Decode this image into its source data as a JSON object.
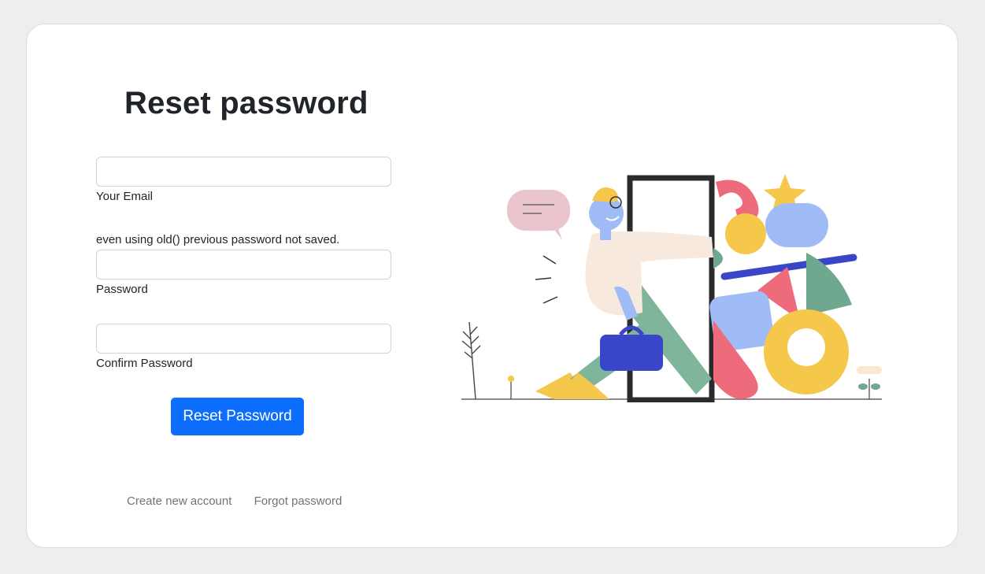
{
  "page": {
    "title": "Reset password"
  },
  "form": {
    "email": {
      "label": "Your Email",
      "value": "",
      "placeholder": ""
    },
    "note": "even using old() previous password not saved.",
    "password": {
      "label": "Password",
      "value": "",
      "placeholder": ""
    },
    "confirm_password": {
      "label": "Confirm Password",
      "value": "",
      "placeholder": ""
    },
    "submit_label": "Reset Password"
  },
  "links": {
    "create_account": "Create new account",
    "forgot_password": "Forgot password"
  },
  "colors": {
    "primary": "#0d6efd",
    "page_background": "#eeeeee",
    "card_background": "#ffffff"
  }
}
